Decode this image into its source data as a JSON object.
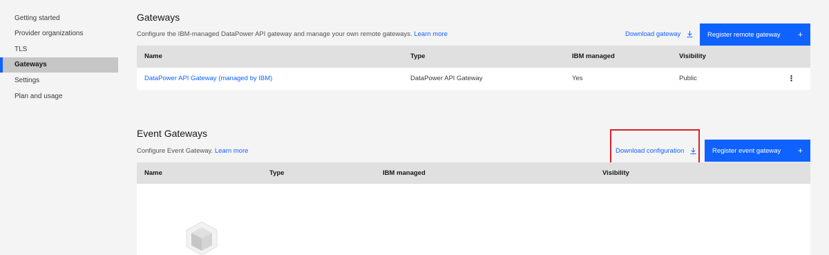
{
  "sidebar": {
    "items": [
      {
        "label": "Getting started"
      },
      {
        "label": "Provider organizations"
      },
      {
        "label": "TLS"
      },
      {
        "label": "Gateways"
      },
      {
        "label": "Settings"
      },
      {
        "label": "Plan and usage"
      }
    ],
    "active": "Gateways"
  },
  "gateways": {
    "title": "Gateways",
    "description": "Configure the IBM-managed DataPower API gateway and manage your own remote gateways.",
    "learn_more": "Learn more",
    "download_label": "Download gateway",
    "register_label": "Register remote gateway",
    "columns": [
      "Name",
      "Type",
      "IBM managed",
      "Visibility"
    ],
    "rows": [
      {
        "name": "DataPower API Gateway (managed by IBM)",
        "type": "DataPower API Gateway",
        "ibm_managed": "Yes",
        "visibility": "Public"
      }
    ]
  },
  "event_gateways": {
    "title": "Event Gateways",
    "description": "Configure Event Gateway.",
    "learn_more": "Learn more",
    "download_label": "Download configuration",
    "register_label": "Register event gateway",
    "columns": [
      "Name",
      "Type",
      "IBM managed",
      "Visibility"
    ]
  },
  "icons": {
    "plus": "+",
    "overflow": "⋮",
    "download": "download-icon"
  },
  "colors": {
    "accent": "#0f62fe",
    "highlight": "#da1e28"
  }
}
